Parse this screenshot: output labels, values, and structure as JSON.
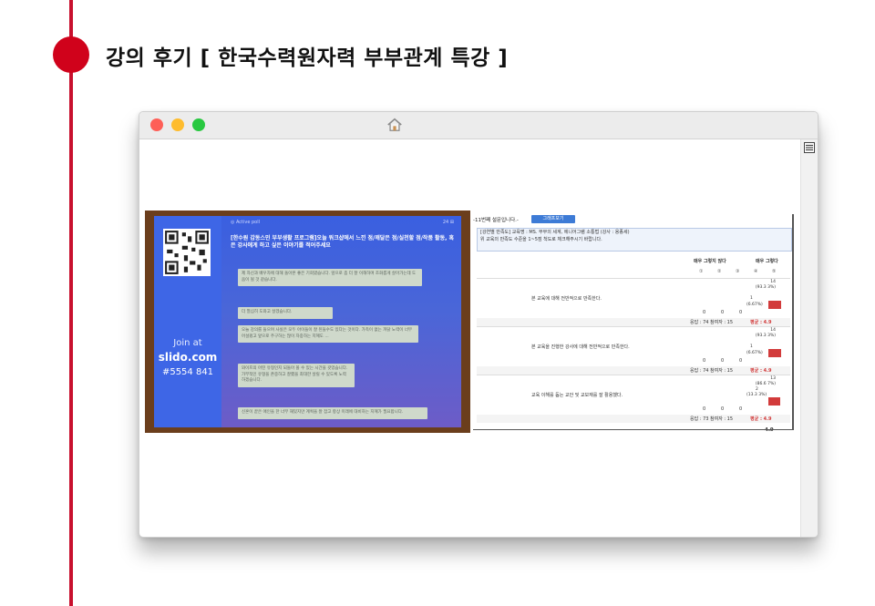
{
  "heading": "강의 후기 [ 한국수력원자력 부부관계 특강 ]",
  "icons": {
    "home": "home-icon",
    "menu": "menu-icon"
  },
  "colors": {
    "accent": "#c8102e",
    "slido_blue": "#3e66e6",
    "bar_red": "#d23b3b"
  },
  "slido": {
    "poll_tag": "◎ Active poll",
    "poll_count": "24 ⊞",
    "question": "[한수원 갑동스민 부부생활 프로그램]오늘 워크샵에서 느낀 점/깨달은 점/실천할 점/작품 활동, 혹은 강사에게 하고 싶은 이야기를 적어주세요",
    "join_at": "Join at",
    "site": "slido.com",
    "code": "#5554 841",
    "answers": [
      "제 자신과 배우자에 대해 돌아본 좋은 기회였습니다. 앞으로 좀 더 잘 이해하며 조화롭게 살아가는데 도움이 될 것 같습니다.",
      "더 열심히 도와고 살겠습니다.",
      "오늘 강의를 들으며 사실은 모두 아이들이 잘 된들수도 있다는 것이다. 가족이 없는 까닭 노력이 너무 어설펐고 앞으로 주구하는 많이 자중하는 지혜도 ...",
      "와이프의 어떤 유형인지 되돌아 볼 수 있는 시간을 갖었습니다. 가부적인 유형을 존중하고 잘했을 최대한 살릴 수 있도록 노력 하겠습니다.",
      "신혼이 끝은 애인을 한 너무 재밌지만 계획을 잘 잡고 항상 미래에 대비하는 지혜가 필요합니다."
    ]
  },
  "survey": {
    "header": "-11번째 설문입니다.-",
    "graph_button": "그래프보기",
    "info_line1": "[강연별 만족도] 교육명 : MS. 부부의 세계, 에니어그램 소통법 (강사 : 용종세)",
    "info_line2": "위 교육의 만족도 수준을 1~5점 척도로 체크해주시기 바랍니다.",
    "col_low": "매우 그렇지 않다",
    "col_high": "매우 그렇다",
    "scale": [
      "①",
      "②",
      "③",
      "④",
      "⑤"
    ],
    "rows": [
      {
        "question": "본 교육에 대해 전반적으로 만족한다.",
        "zeros": [
          "0",
          "0",
          "0"
        ],
        "c4": "1",
        "c4_pct": "(6.67%)",
        "c5": "14",
        "c5_pct": "(93.3 3%)",
        "stats": "응답 : 74    참여자 : 15",
        "avg": "평균 : 4.9",
        "c5_share": 0.933
      },
      {
        "question": "본 교육을 진행한 강사에 대해 전반적으로 만족한다.",
        "zeros": [
          "0",
          "0",
          "0"
        ],
        "c4": "1",
        "c4_pct": "(6.67%)",
        "c5": "14",
        "c5_pct": "(93.3 3%)",
        "stats": "응답 : 74    참여자 : 15",
        "avg": "평균 : 4.9",
        "c5_share": 0.933
      },
      {
        "question": "교육 이해를 돕는 교안 및 교보재를 잘 활용했다.",
        "zeros": [
          "0",
          "0",
          "0"
        ],
        "c4": "2",
        "c4_pct": "(13.3 3%)",
        "c5": "13",
        "c5_pct": "(86.6 7%)",
        "stats": "응답 : 73    참여자 : 15",
        "avg": "평균 : 4.9",
        "c5_share": 0.867
      }
    ],
    "total": "4.9"
  }
}
